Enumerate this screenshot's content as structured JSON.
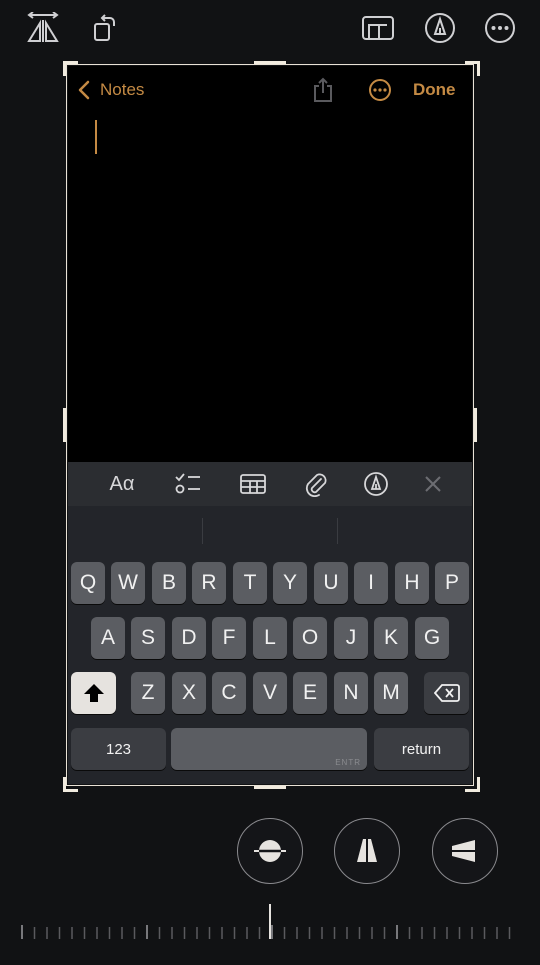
{
  "header": {
    "icons": [
      "flip-horizontal-icon",
      "rotate-icon",
      "aspect-ratio-icon",
      "markup-pen-icon",
      "more-options-icon"
    ]
  },
  "notes": {
    "back_label": "Notes",
    "done_label": "Done"
  },
  "toolbar": {
    "format_label": "Aα"
  },
  "keyboard": {
    "row1": [
      "Q",
      "W",
      "B",
      "R",
      "T",
      "Y",
      "U",
      "I",
      "H",
      "P"
    ],
    "row2": [
      "A",
      "S",
      "D",
      "F",
      "L",
      "O",
      "J",
      "K",
      "G"
    ],
    "row3": [
      "Z",
      "X",
      "C",
      "V",
      "E",
      "N",
      "M"
    ],
    "numbers_label": "123",
    "space_hint": "ENTR",
    "return_label": "return"
  },
  "perspective_controls": [
    "horizon-icon",
    "vertical-perspective-icon",
    "horizontal-perspective-icon"
  ],
  "colors": {
    "accent": "#c48a44",
    "background": "#111214",
    "key": "#5b5d62",
    "toolbar": "#2b2d31"
  }
}
